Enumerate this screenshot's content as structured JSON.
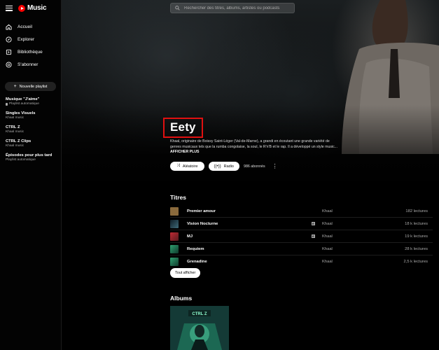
{
  "app": {
    "logo_text": "Music",
    "brand_color": "#ff0000"
  },
  "nav": {
    "items": [
      {
        "label": "Accueil",
        "icon": "home-icon"
      },
      {
        "label": "Explorer",
        "icon": "compass-icon"
      },
      {
        "label": "Bibliothèque",
        "icon": "library-icon"
      },
      {
        "label": "S'abonner",
        "icon": "subscribe-icon"
      }
    ],
    "new_playlist_label": "Nouvelle playlist"
  },
  "playlists": [
    {
      "title": "Musique \"J'aime\"",
      "subtitle": "Playlist automatique",
      "pinned": true
    },
    {
      "title": "Singles Visuels",
      "subtitle": "Khaal music"
    },
    {
      "title": "CTRL Z",
      "subtitle": "Khaal music"
    },
    {
      "title": "CTRL Z Clips",
      "subtitle": "Khaal music"
    },
    {
      "title": "Épisodes pour plus tard",
      "subtitle": "Playlist automatique"
    }
  ],
  "search": {
    "placeholder": "Rechercher des titres, albums, artistes ou podcasts"
  },
  "artist": {
    "name": "Eety",
    "description_line1": "Khaal, originaire de Boissy Saint-Léger (Val-de-Marne), a grandi en écoutant une grande variété de",
    "description_line2": "genres musicaux tels que la rumba congolaise, la soul, le R'n'B et le rap. Il a développé un style music...",
    "show_more": "AFFICHER PLUS",
    "shuffle_label": "Aléatoire",
    "radio_label": "Radio",
    "subscribers": "986 abonnés"
  },
  "tracks_section": {
    "title": "Titres",
    "see_all_label": "Tout afficher",
    "tracks": [
      {
        "title": "Premier amour",
        "explicit": false,
        "artist": "Khaal",
        "plays": "182 lectures",
        "thumb_color": "#8a6a3c"
      },
      {
        "title": "Vision Nocturne",
        "explicit": true,
        "artist": "Khaal",
        "plays": "18 k lectures",
        "thumb_color": "#24404a"
      },
      {
        "title": "MJ",
        "explicit": true,
        "artist": "Khaal",
        "plays": "19 k lectures",
        "thumb_color": "#9a2530"
      },
      {
        "title": "Requiem",
        "explicit": false,
        "artist": "Khaal",
        "plays": "28 k lectures",
        "thumb_color": "#1f6e50"
      },
      {
        "title": "Grenadine",
        "explicit": false,
        "artist": "Khaal",
        "plays": "2,5 k lectures",
        "thumb_color": "#1f6e50"
      }
    ]
  },
  "albums_section": {
    "title": "Albums",
    "albums": [
      {
        "cover_text": "CTRL Z",
        "cover_color": "#0c2a2c"
      }
    ]
  }
}
